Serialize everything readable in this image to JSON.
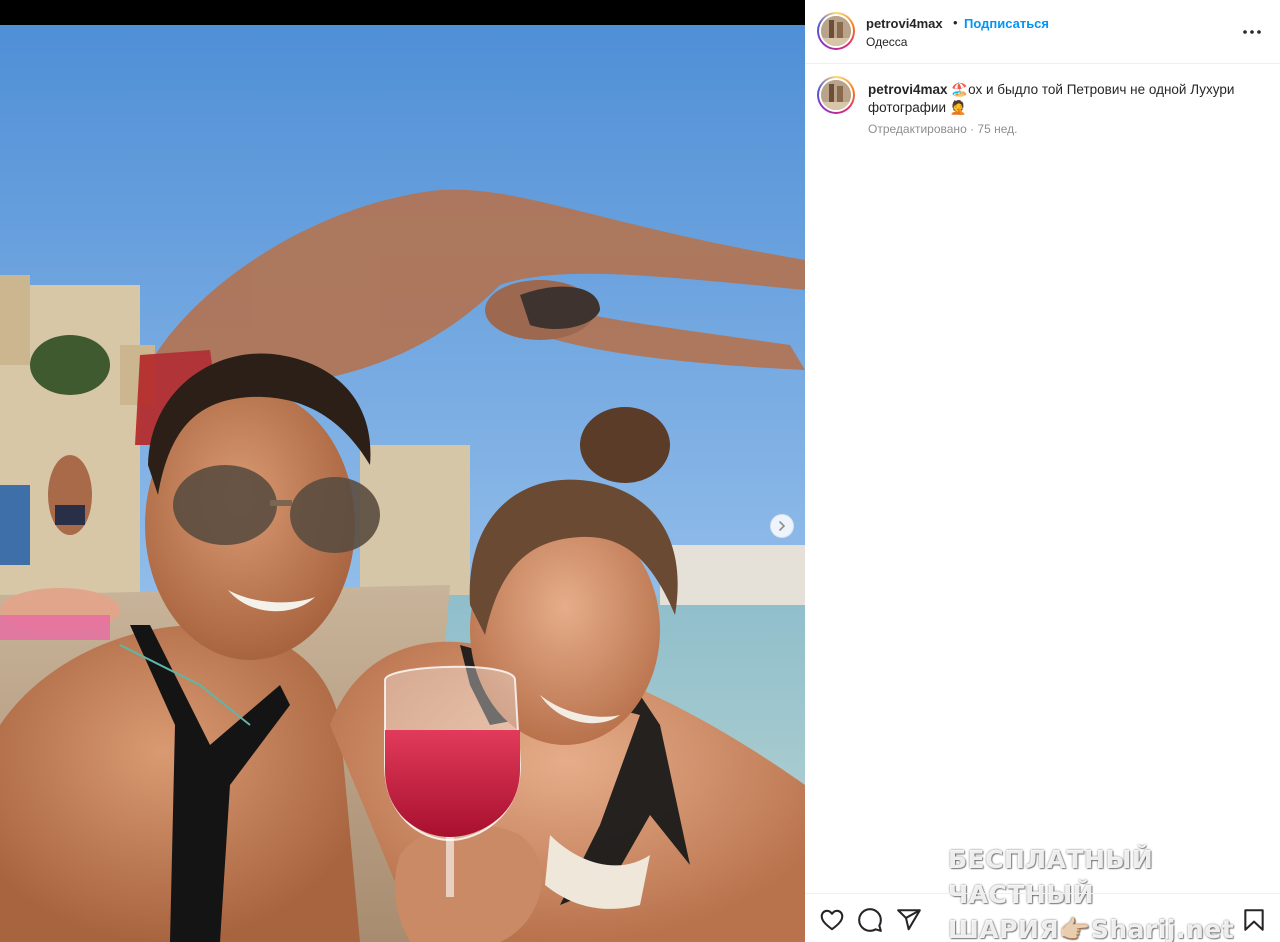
{
  "post": {
    "username": "petrovi4max",
    "follow_label": "Подписаться",
    "separator": "•",
    "location": "Одесса"
  },
  "caption": {
    "username": "petrovi4max",
    "text": "ох и быдло той Петрович не одной Лухури фотографии",
    "emoji_start": "🏖️",
    "emoji_end": "🤦",
    "meta": "Отредактировано · 75 нед."
  },
  "watermark": {
    "line1": "БЕСПЛАТНЫЙ ЧАСТНЫЙ",
    "line2": "ШАРИЯ👉🏻Sharij.net"
  },
  "icons": {
    "more": "more-horizontal-icon",
    "like": "heart-icon",
    "comment": "comment-icon",
    "share": "share-icon",
    "save": "bookmark-icon",
    "next": "chevron-right-icon"
  },
  "colors": {
    "follow": "#0095f6",
    "text": "#262626",
    "meta": "#8e8e8e",
    "sky": "#5d97d9"
  }
}
